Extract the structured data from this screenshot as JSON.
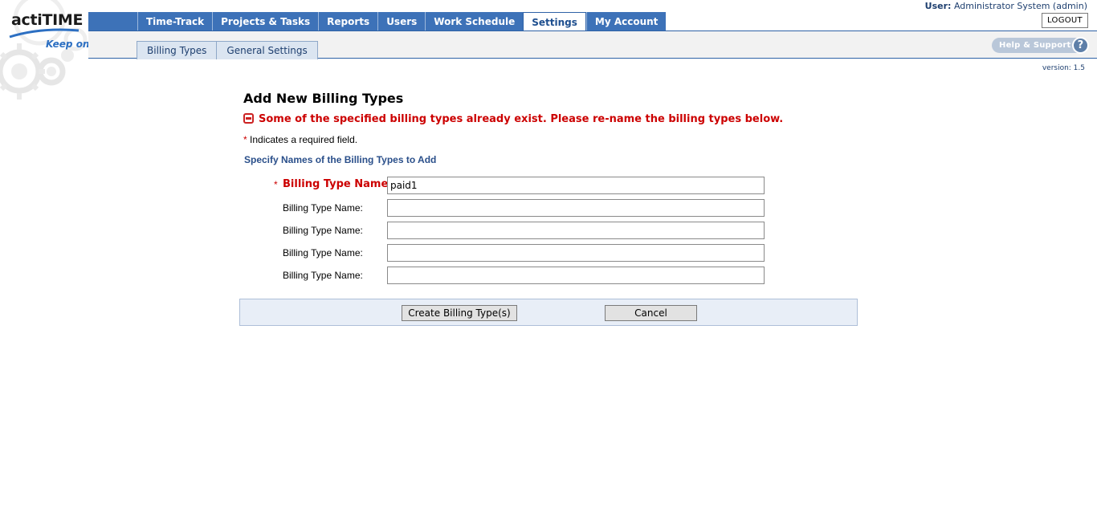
{
  "app": {
    "logo_text": "actiTIME",
    "tagline": "Keep on trackin'",
    "version": "version: 1.5"
  },
  "topnav": {
    "tabs": [
      {
        "label": "Time-Track"
      },
      {
        "label": "Projects & Tasks"
      },
      {
        "label": "Reports"
      },
      {
        "label": "Users"
      },
      {
        "label": "Work Schedule"
      },
      {
        "label": "Settings",
        "active": true
      },
      {
        "label": "My Account"
      }
    ]
  },
  "user": {
    "prefix": "User:",
    "name": "Administrator System (admin)",
    "logout_label": "LOGOUT"
  },
  "subnav": {
    "tabs": [
      {
        "label": "Billing Types"
      },
      {
        "label": "General Settings"
      }
    ]
  },
  "help": {
    "label": "Help & Support",
    "icon": "?"
  },
  "form": {
    "title": "Add New Billing Types",
    "error": "Some of the specified billing types already exist. Please re-name the billing types below.",
    "required_star": "*",
    "required_note": "Indicates a required field.",
    "section_title": "Specify Names of the Billing Types to Add",
    "rows": [
      {
        "label": "Billing Type Name:",
        "value": "paid1",
        "error": true
      },
      {
        "label": "Billing Type Name:",
        "value": ""
      },
      {
        "label": "Billing Type Name:",
        "value": ""
      },
      {
        "label": "Billing Type Name:",
        "value": ""
      },
      {
        "label": "Billing Type Name:",
        "value": ""
      }
    ],
    "create_label": "Create Billing Type(s)",
    "cancel_label": "Cancel"
  },
  "colors": {
    "nav_blue": "#3d72b8",
    "error_red": "#cc0000",
    "section_blue": "#2a4f8a"
  }
}
